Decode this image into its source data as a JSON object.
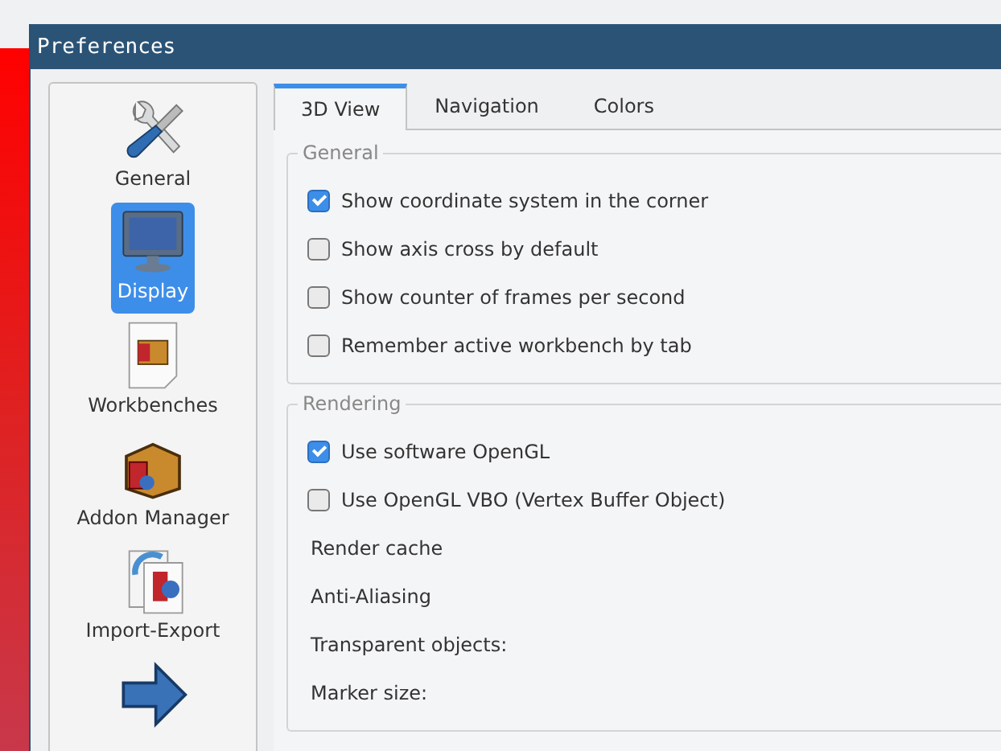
{
  "window": {
    "title": "Preferences"
  },
  "sidebar": {
    "items": [
      {
        "label": "General",
        "selected": false
      },
      {
        "label": "Display",
        "selected": true
      },
      {
        "label": "Workbenches",
        "selected": false
      },
      {
        "label": "Addon Manager",
        "selected": false
      },
      {
        "label": "Import-Export",
        "selected": false
      },
      {
        "selected": false
      }
    ]
  },
  "tabs": [
    {
      "label": "3D View",
      "selected": true
    },
    {
      "label": "Navigation",
      "selected": false
    },
    {
      "label": "Colors",
      "selected": false
    }
  ],
  "groups": [
    {
      "title": "General",
      "rows": [
        {
          "kind": "checkbox",
          "label": "Show coordinate system in the corner",
          "checked": true
        },
        {
          "kind": "checkbox",
          "label": "Show axis cross by default",
          "checked": false
        },
        {
          "kind": "checkbox",
          "label": "Show counter of frames per second",
          "checked": false
        },
        {
          "kind": "checkbox",
          "label": "Remember active workbench by tab",
          "checked": false
        }
      ]
    },
    {
      "title": "Rendering",
      "rows": [
        {
          "kind": "checkbox",
          "label": "Use software OpenGL",
          "checked": true
        },
        {
          "kind": "checkbox",
          "label": "Use OpenGL VBO (Vertex Buffer Object)",
          "checked": false
        },
        {
          "kind": "label",
          "label": "Render cache"
        },
        {
          "kind": "label",
          "label": "Anti-Aliasing"
        },
        {
          "kind": "label",
          "label": "Transparent objects:"
        },
        {
          "kind": "label",
          "label": "Marker size:"
        }
      ]
    }
  ]
}
